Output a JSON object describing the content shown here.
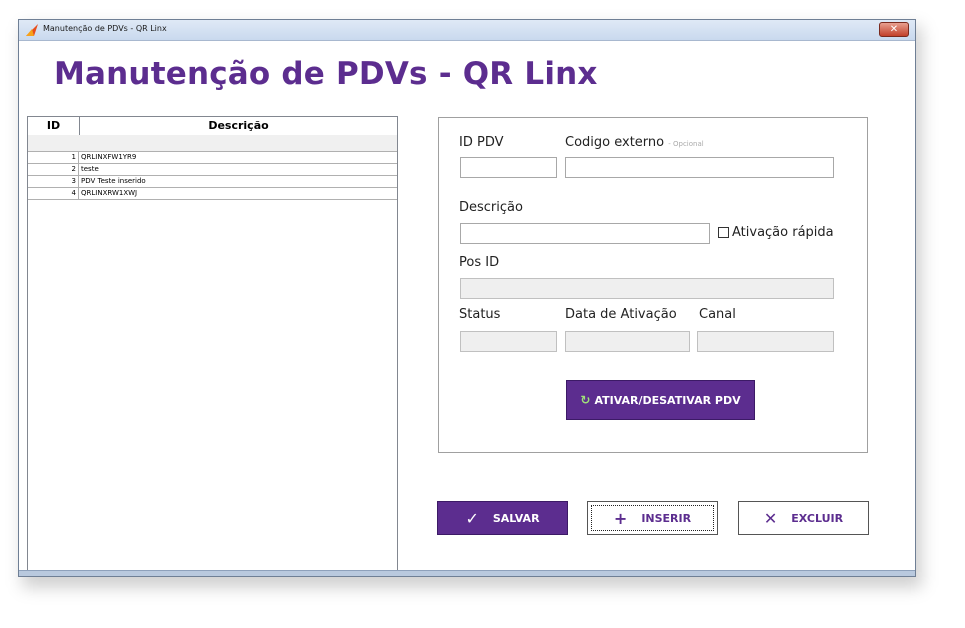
{
  "window": {
    "title": "Manutenção de PDVs - QR Linx",
    "close_label": "✕"
  },
  "page": {
    "title": "Manutenção de PDVs - QR Linx"
  },
  "grid": {
    "columns": {
      "id": "ID",
      "description": "Descrição"
    },
    "rows": [
      {
        "id": "1",
        "description": "QRLINXFW1YR9"
      },
      {
        "id": "2",
        "description": "teste"
      },
      {
        "id": "3",
        "description": "PDV Teste inserido"
      },
      {
        "id": "4",
        "description": "QRLINXRW1XWJ"
      }
    ]
  },
  "form": {
    "id_pdv_label": "ID PDV",
    "external_code_label": "Codigo externo",
    "external_code_hint": "- Opcional",
    "description_label": "Descrição",
    "quick_activation_label": "Ativação rápida",
    "quick_activation_checked": false,
    "pos_id_label": "Pos ID",
    "status_label": "Status",
    "activation_date_label": "Data de Ativação",
    "channel_label": "Canal",
    "toggle_button_label": "ATIVAR/DESATIVAR PDV"
  },
  "actions": {
    "save_label": "SALVAR",
    "insert_label": "INSERIR",
    "delete_label": "EXCLUIR"
  },
  "colors": {
    "brand": "#5c2d8f",
    "accent_icon": "#9fe07a"
  }
}
